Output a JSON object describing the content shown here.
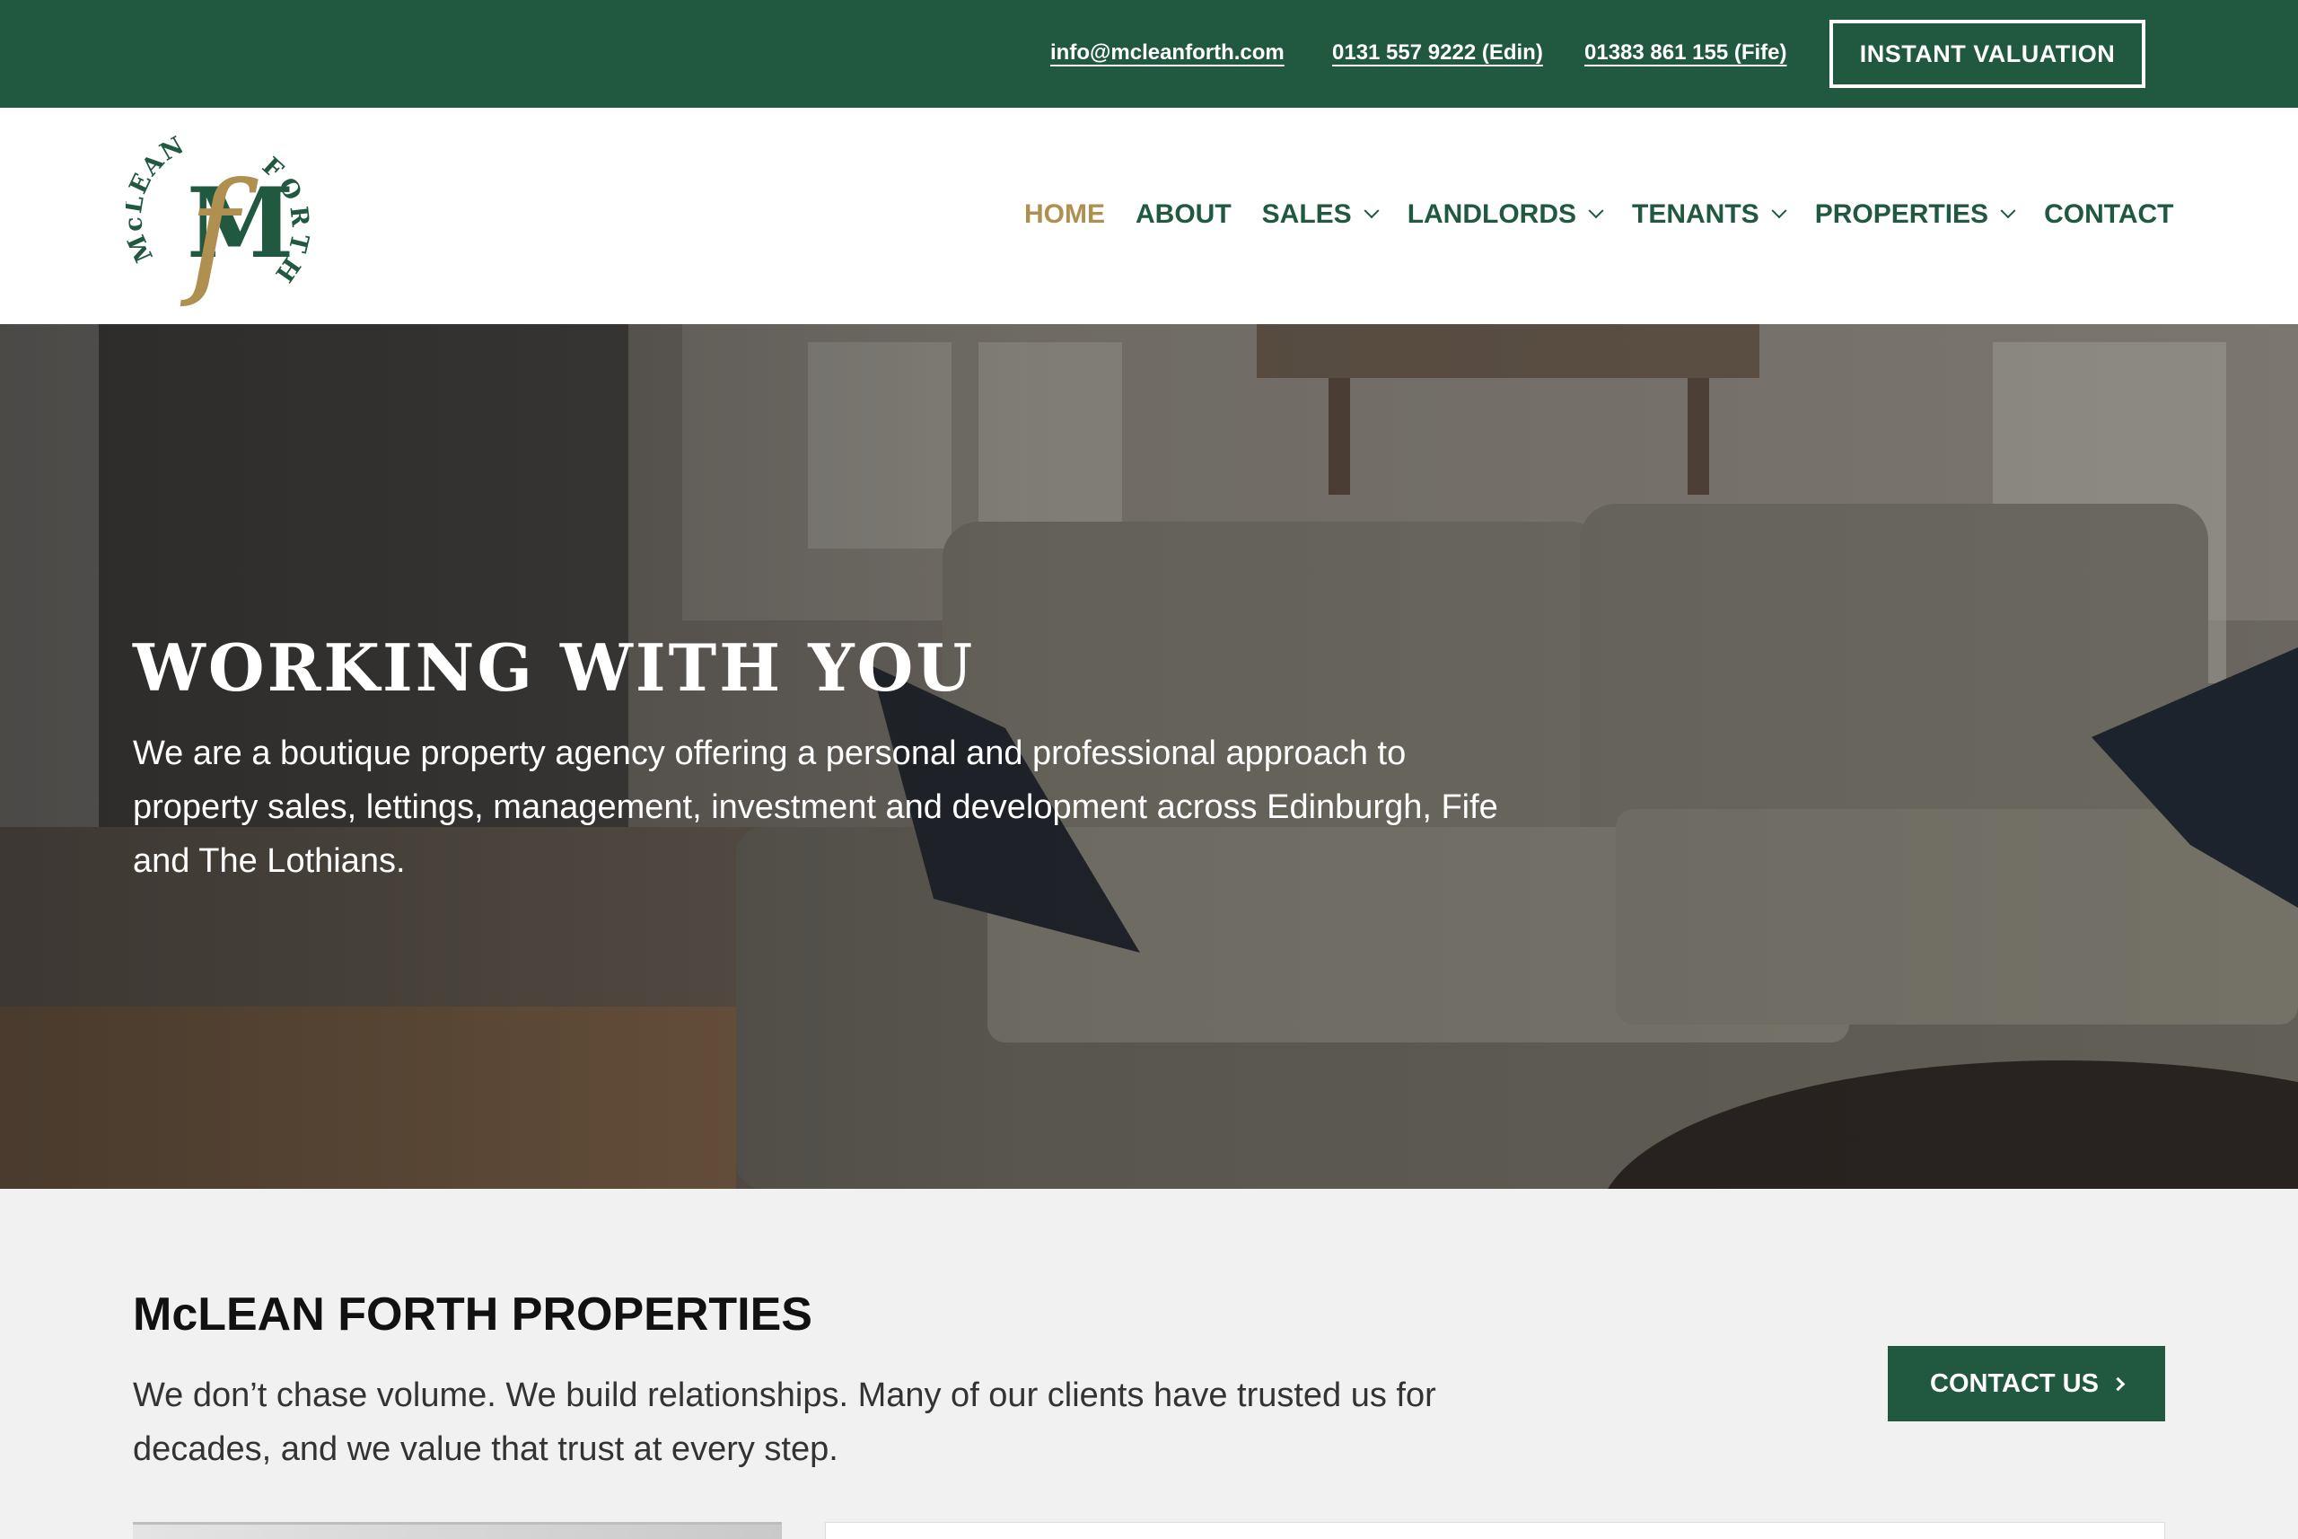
{
  "topbar": {
    "email": "info@mcleanforth.com",
    "phone_edin": "0131 557 9222 (Edin)",
    "phone_fife": "01383 861 155 (Fife)",
    "cta_label": "INSTANT VALUATION"
  },
  "logo": {
    "ring_top": "McLEAN",
    "ring_right": "FORTH",
    "monogram_f": "f",
    "monogram_m": "M",
    "icon": "mclean-forth-logo"
  },
  "nav": {
    "home": "HOME",
    "about": "ABOUT",
    "sales": "SALES",
    "landlords": "LANDLORDS",
    "tenants": "TENANTS",
    "properties": "PROPERTIES",
    "contact": "CONTACT"
  },
  "hero": {
    "title": "WORKING WITH YOU",
    "text": "We are a boutique property agency offering a personal and professional approach to property sales, lettings, management, investment and development across Edinburgh, Fife and The Lothians."
  },
  "section": {
    "title": "McLEAN FORTH PROPERTIES",
    "text": "We don’t chase volume. We build relationships. Many of our clients have trusted us for decades, and we value that trust at every step.",
    "contact_label": "CONTACT US"
  },
  "colors": {
    "brand_green": "#215940",
    "brand_gold": "#b09050",
    "white": "#ffffff"
  }
}
